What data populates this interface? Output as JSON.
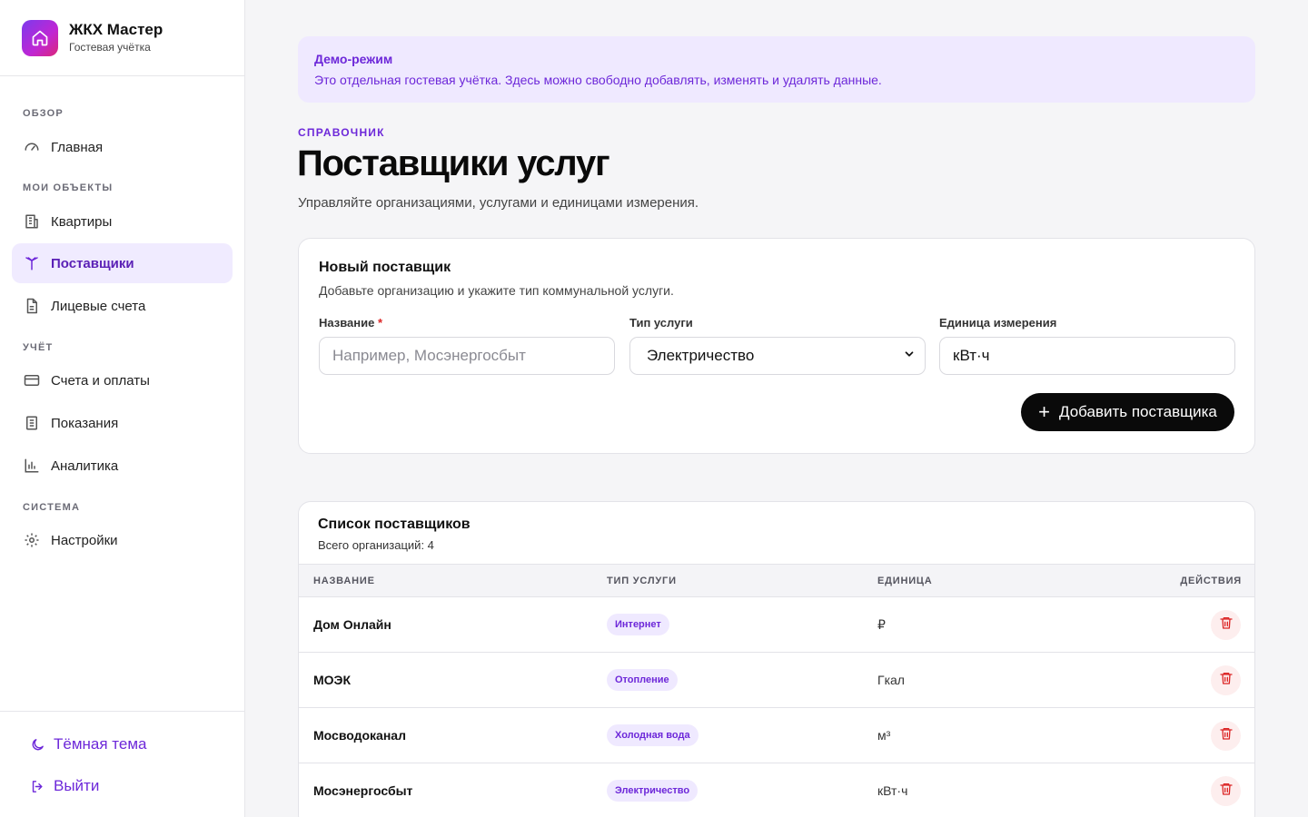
{
  "app": {
    "title": "ЖКХ Мастер",
    "subtitle": "Гостевая учётка"
  },
  "sidebar": {
    "sections": [
      "ОБЗОР",
      "МОИ ОБЪЕКТЫ",
      "УЧЁТ",
      "СИСТЕМА"
    ],
    "items": [
      {
        "label": "Главная",
        "icon": "gauge-icon"
      },
      {
        "label": "Квартиры",
        "icon": "building-icon"
      },
      {
        "label": "Поставщики",
        "icon": "antenna-icon",
        "active": true
      },
      {
        "label": "Лицевые счета",
        "icon": "document-icon"
      },
      {
        "label": "Счета и оплаты",
        "icon": "credit-card-icon"
      },
      {
        "label": "Показания",
        "icon": "list-document-icon"
      },
      {
        "label": "Аналитика",
        "icon": "bar-chart-icon"
      },
      {
        "label": "Настройки",
        "icon": "gear-icon"
      }
    ],
    "bottom": {
      "theme_label": "Тёмная тема",
      "logout_label": "Выйти"
    }
  },
  "demo": {
    "title": "Демо-режим",
    "text": "Это отдельная гостевая учётка. Здесь можно свободно добавлять, изменять и удалять данные."
  },
  "page": {
    "eyebrow": "СПРАВОЧНИК",
    "title": "Поставщики услуг",
    "subtitle": "Управляйте организациями, услугами и единицами измерения."
  },
  "form": {
    "title": "Новый поставщик",
    "subtitle": "Добавьте организацию и укажите тип коммунальной услуги.",
    "name_label": "Название",
    "required_mark": "*",
    "name_placeholder": "Например, Мосэнергосбыт",
    "type_label": "Тип услуги",
    "type_value": "Электричество",
    "unit_label": "Единица измерения",
    "unit_value": "кВт·ч",
    "submit_label": "Добавить поставщика"
  },
  "list": {
    "title": "Список поставщиков",
    "count_text": "Всего организаций: 4",
    "columns": [
      "НАЗВАНИЕ",
      "ТИП УСЛУГИ",
      "ЕДИНИЦА",
      "ДЕЙСТВИЯ"
    ],
    "rows": [
      {
        "name": "Дом Онлайн",
        "type": "Интернет",
        "unit": "₽"
      },
      {
        "name": "МОЭК",
        "type": "Отопление",
        "unit": "Гкал"
      },
      {
        "name": "Мосводоканал",
        "type": "Холодная вода",
        "unit": "м³"
      },
      {
        "name": "Мосэнергосбыт",
        "type": "Электричество",
        "unit": "кВт·ч"
      }
    ]
  },
  "colors": {
    "accent": "#6d28d9",
    "active_bg": "#f0ebff",
    "danger": "#dc2626"
  }
}
